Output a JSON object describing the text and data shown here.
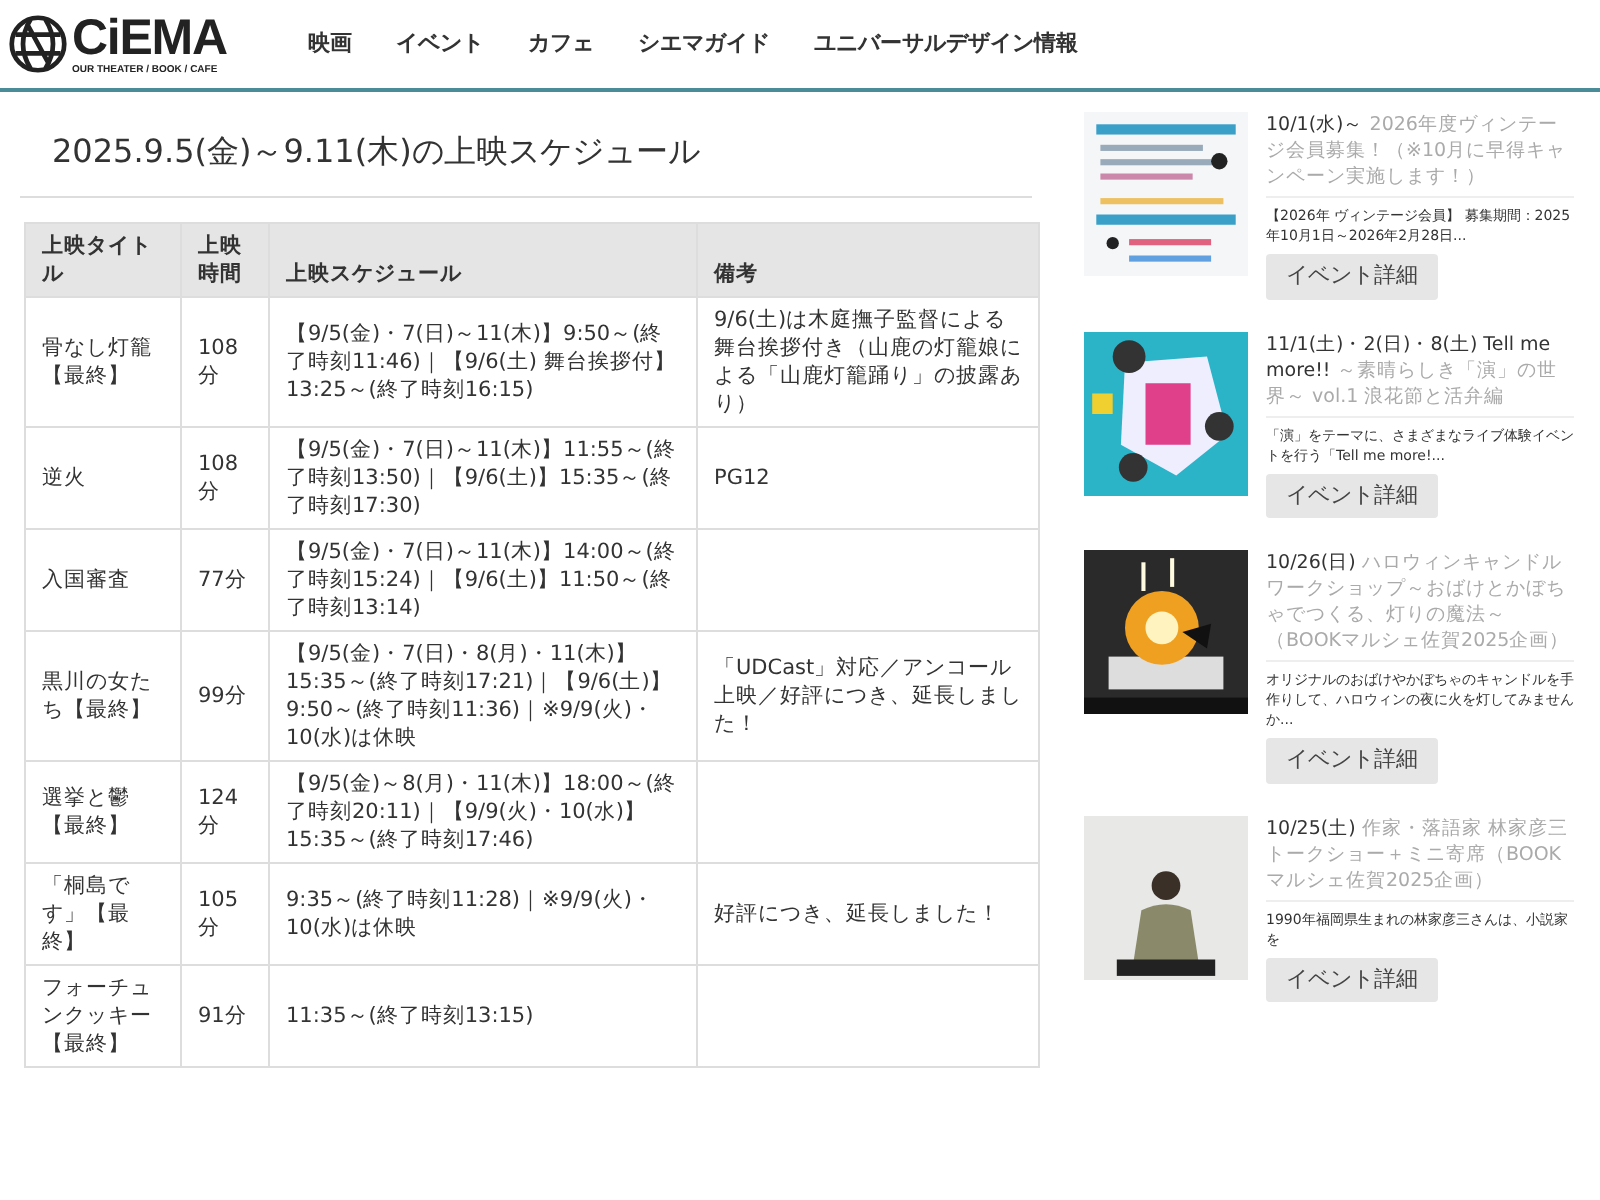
{
  "logo": {
    "name": "CiEMA",
    "tagline": "OUR THEATER / BOOK / CAFE"
  },
  "nav": [
    "映画",
    "イベント",
    "カフェ",
    "シエマガイド",
    "ユニバーサルデザイン情報"
  ],
  "page_title": "2025.9.5(金)～9.11(木)の上映スケジュール",
  "table": {
    "columns": [
      "上映タイトル",
      "上映時間",
      "上映スケジュール",
      "備考"
    ],
    "rows": [
      {
        "title": "骨なし灯籠【最終】",
        "runtime": "108分",
        "schedule": "【9/5(金)・7(日)～11(木)】9:50～(終了時刻11:46)｜【9/6(土) 舞台挨拶付】13:25～(終了時刻16:15)",
        "note": "9/6(土)は木庭撫子監督による舞台挨拶付き（山鹿の灯籠娘による「山鹿灯籠踊り」の披露あり）"
      },
      {
        "title": "逆火",
        "runtime": "108分",
        "schedule": "【9/5(金)・7(日)～11(木)】11:55～(終了時刻13:50)｜【9/6(土)】15:35～(終了時刻17:30)",
        "note": "PG12"
      },
      {
        "title": "入国審査",
        "runtime": "77分",
        "schedule": "【9/5(金)・7(日)～11(木)】14:00～(終了時刻15:24)｜【9/6(土)】11:50～(終了時刻13:14)"
      },
      {
        "title": "黒川の女たち【最終】",
        "runtime": "99分",
        "schedule": "【9/5(金)・7(日)・8(月)・11(木)】15:35～(終了時刻17:21)｜【9/6(土)】9:50～(終了時刻11:36)｜※9/9(火)・10(水)は休映",
        "note": "「UDCast」対応／アンコール上映／好評につき、延長しました！"
      },
      {
        "title": "選挙と鬱【最終】",
        "runtime": "124分",
        "schedule": "【9/5(金)～8(月)・11(木)】18:00～(終了時刻20:11)｜【9/9(火)・10(水)】15:35～(終了時刻17:46)"
      },
      {
        "title": "「桐島です」【最終】",
        "runtime": "105分",
        "schedule": "9:35～(終了時刻11:28)｜※9/9(火)・10(水)は休映",
        "note": "好評につき、延長しました！"
      },
      {
        "title": "フォーチュンクッキー【最終】",
        "runtime": "91分",
        "schedule": "11:35～(終了時刻13:15)"
      }
    ]
  },
  "events": [
    {
      "kind": "flyer",
      "date": "10/1(水)～",
      "title": " 2026年度ヴィンテージ会員募集！（※10月に早得キャンペーン実施します！）",
      "desc": "【2026年 ヴィンテージ会員】 募集期間：2025年10月1日～2026年2月28日...",
      "button": "イベント詳細"
    },
    {
      "kind": "poster",
      "date": "11/1(土)・2(日)・8(土) Tell me more!!",
      "title": " ～素晴らしき「演」の世界～ vol.1 浪花節と活弁編",
      "desc": "「演」をテーマに、さまざまなライブ体験イベントを行う「Tell me more!...",
      "button": "イベント詳細"
    },
    {
      "kind": "candle",
      "date": "10/26(日)",
      "title": " ハロウィンキャンドルワークショップ～おばけとかぼちゃでつくる、灯りの魔法～（BOOKマルシェ佐賀2025企画）",
      "desc": "オリジナルのおばけやかぼちゃのキャンドルを手作りして、ハロウィンの夜に火を灯してみませんか...",
      "button": "イベント詳細"
    },
    {
      "kind": "person",
      "date": "10/25(土)",
      "title": " 作家・落語家 林家彦三トークショー＋ミニ寄席（BOOKマルシェ佐賀2025企画）",
      "desc": "1990年福岡県生まれの林家彦三さんは、小説家を",
      "button": "イベント詳細"
    }
  ]
}
